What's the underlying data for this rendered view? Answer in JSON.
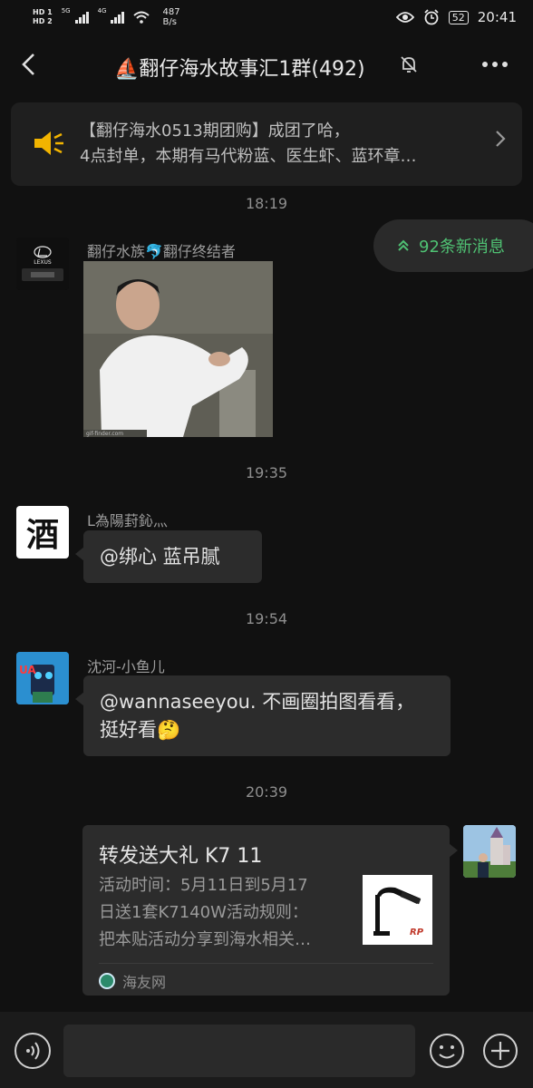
{
  "status_bar": {
    "hd1": "HD 1",
    "hd2": "HD 2",
    "net1": "5G",
    "net2": "4G",
    "speed_value": "487",
    "speed_unit": "B/s",
    "battery": "52",
    "time": "20:41"
  },
  "header": {
    "title": "⛵翻仔海水故事汇1群(492)",
    "icons": [
      "back-icon",
      "mute-bell-icon",
      "more-icon"
    ]
  },
  "notice": {
    "line1": "【翻仔海水0513期团购】成团了哈，",
    "line2": "4点封单，本期有马代粉蓝、医生虾、蓝环章…",
    "icon": "speaker-icon"
  },
  "new_messages": {
    "label": "92条新消息",
    "icon": "double-chevron-up-icon"
  },
  "messages": [
    {
      "time": "18:19",
      "sender": "翻仔水族🐬翻仔终结者",
      "type": "gif",
      "gif_caption": "gif-finder.com",
      "avatar_text": "LEXUS"
    },
    {
      "time": "19:35",
      "sender": "L為陽葑鈊灬",
      "type": "text",
      "text": "@绑心  蓝吊腻",
      "avatar_text": "酒"
    },
    {
      "time": "19:54",
      "sender": "沈河-小鱼儿",
      "type": "text",
      "line1": "@wannaseeyou. 不画圈拍图看看，",
      "line2": "挺好看🤔",
      "avatar_text": "UA"
    },
    {
      "time": "20:39",
      "type": "link",
      "title": "转发送大礼 K7 11",
      "desc1": "活动时间：5月11日到5月17",
      "desc2": "日送1套K7140W活动规则：",
      "desc3": "把本贴活动分享到海水相关…",
      "source": "海友网",
      "thumb_text": "RP"
    }
  ],
  "input_bar": {
    "placeholder": "",
    "icons": [
      "voice-icon",
      "emoji-icon",
      "plus-icon"
    ]
  },
  "colors": {
    "background": "#111111",
    "bubble": "#2c2c2c",
    "accent_green": "#4fc173",
    "speaker_yellow": "#f2b400"
  }
}
